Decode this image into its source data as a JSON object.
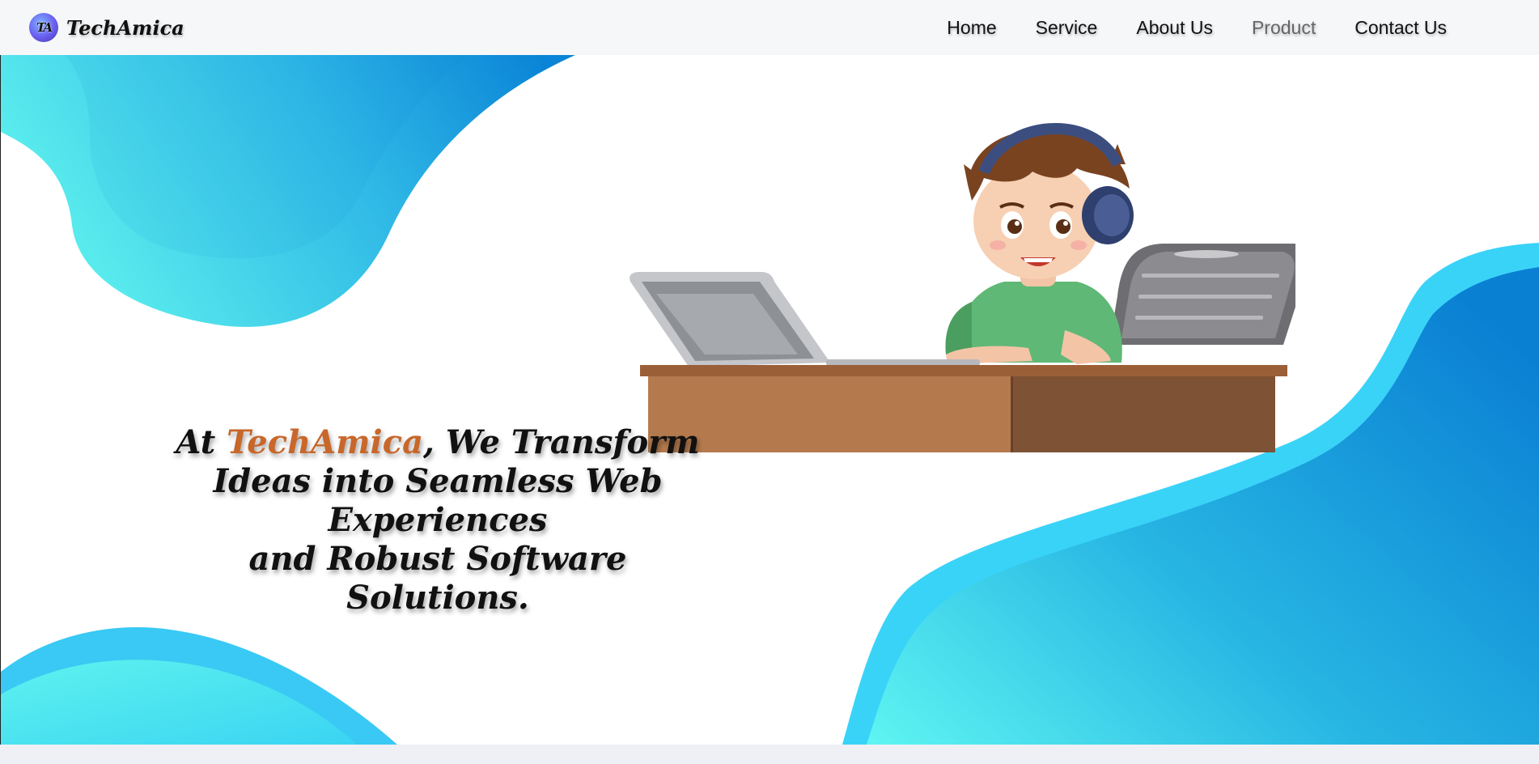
{
  "brand": {
    "logo_text": "TA",
    "name": "TechAmica"
  },
  "nav": {
    "items": [
      {
        "label": "Home"
      },
      {
        "label": "Service"
      },
      {
        "label": "About Us"
      },
      {
        "label": "Product",
        "active": true
      },
      {
        "label": "Contact Us"
      }
    ]
  },
  "hero": {
    "headline_prefix": "At ",
    "headline_brand": "TechAmica",
    "headline_line1_rest": ", We Transform",
    "headline_line2": "Ideas into Seamless Web",
    "headline_line3": "Experiences",
    "headline_line4": "and Robust Software Solutions."
  },
  "colors": {
    "accent_orange": "#c8672a",
    "wave_light": "#5cf0ee",
    "wave_mid": "#3ad3f5",
    "wave_dark": "#0a84d6",
    "nav_active": "#666666"
  }
}
